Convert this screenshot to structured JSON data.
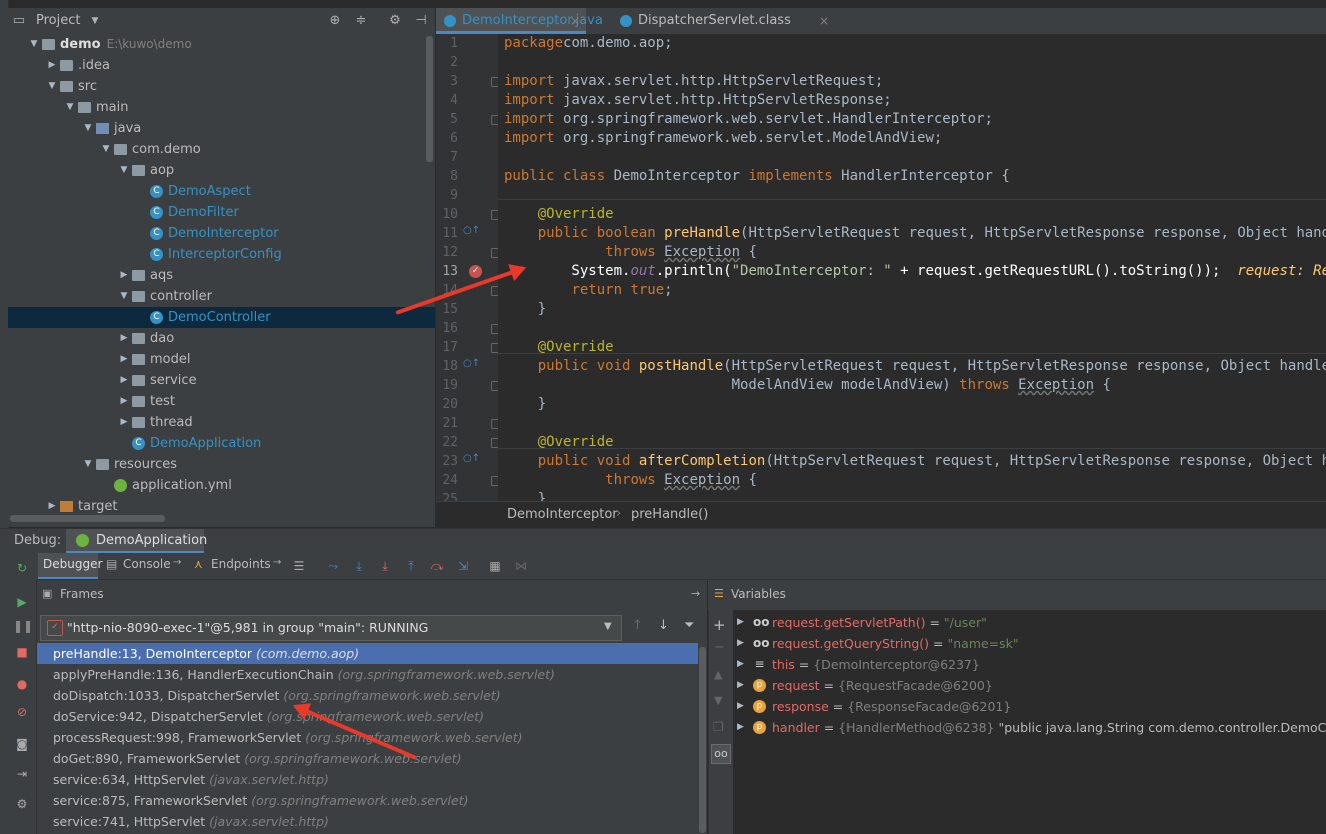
{
  "project_panel": {
    "title": "Project",
    "tree": [
      {
        "label": "demo",
        "path": "E:\\kuwo\\demo",
        "indent": 0,
        "arrow": "down",
        "icon": "folder-module",
        "bold": true
      },
      {
        "label": ".idea",
        "indent": 1,
        "arrow": "right",
        "icon": "folder"
      },
      {
        "label": "src",
        "indent": 1,
        "arrow": "down",
        "icon": "folder"
      },
      {
        "label": "main",
        "indent": 2,
        "arrow": "down",
        "icon": "folder"
      },
      {
        "label": "java",
        "indent": 3,
        "arrow": "down",
        "icon": "folder-blue"
      },
      {
        "label": "com.demo",
        "indent": 4,
        "arrow": "down",
        "icon": "folder"
      },
      {
        "label": "aop",
        "indent": 5,
        "arrow": "down",
        "icon": "folder"
      },
      {
        "label": "DemoAspect",
        "indent": 6,
        "arrow": "",
        "icon": "class"
      },
      {
        "label": "DemoFilter",
        "indent": 6,
        "arrow": "",
        "icon": "class"
      },
      {
        "label": "DemoInterceptor",
        "indent": 6,
        "arrow": "",
        "icon": "class"
      },
      {
        "label": "InterceptorConfig",
        "indent": 6,
        "arrow": "",
        "icon": "class2"
      },
      {
        "label": "aqs",
        "indent": 5,
        "arrow": "right",
        "icon": "folder"
      },
      {
        "label": "controller",
        "indent": 5,
        "arrow": "down",
        "icon": "folder"
      },
      {
        "label": "DemoController",
        "indent": 6,
        "arrow": "",
        "icon": "class",
        "selected": true
      },
      {
        "label": "dao",
        "indent": 5,
        "arrow": "right",
        "icon": "folder"
      },
      {
        "label": "model",
        "indent": 5,
        "arrow": "right",
        "icon": "folder"
      },
      {
        "label": "service",
        "indent": 5,
        "arrow": "right",
        "icon": "folder"
      },
      {
        "label": "test",
        "indent": 5,
        "arrow": "right",
        "icon": "folder"
      },
      {
        "label": "thread",
        "indent": 5,
        "arrow": "right",
        "icon": "folder"
      },
      {
        "label": "DemoApplication",
        "indent": 5,
        "arrow": "",
        "icon": "spring-class"
      },
      {
        "label": "resources",
        "indent": 3,
        "arrow": "down",
        "icon": "folder-res"
      },
      {
        "label": "application.yml",
        "indent": 4,
        "arrow": "",
        "icon": "spring"
      },
      {
        "label": "target",
        "indent": 1,
        "arrow": "right",
        "icon": "folder-orange"
      }
    ]
  },
  "editor": {
    "tabs": [
      {
        "label": "DemoInterceptor.java",
        "active": true,
        "close": "×"
      },
      {
        "label": "DispatcherServlet.class",
        "active": false,
        "close": "×"
      }
    ],
    "line_numbers": [
      "1",
      "2",
      "3",
      "4",
      "5",
      "6",
      "7",
      "8",
      "9",
      "10",
      "11",
      "12",
      "13",
      "14",
      "15",
      "16",
      "17",
      "18",
      "19",
      "20",
      "21",
      "22",
      "23",
      "24",
      "25"
    ],
    "current_line": "13",
    "breadcrumb": [
      "DemoInterceptor",
      "preHandle()"
    ],
    "breadcrumb_sep": "›"
  },
  "debug": {
    "label": "Debug:",
    "config_tab": "DemoApplication",
    "tabs": [
      "Debugger",
      "Console",
      "Endpoints"
    ],
    "frames_title": "Frames",
    "variables_title": "Variables",
    "thread": "\"http-nio-8090-exec-1\"@5,981 in group \"main\": RUNNING",
    "frames": [
      {
        "method": "preHandle:13, DemoInterceptor",
        "pkg": "(com.demo.aop)",
        "selected": true
      },
      {
        "method": "applyPreHandle:136, HandlerExecutionChain",
        "pkg": "(org.springframework.web.servlet)"
      },
      {
        "method": "doDispatch:1033, DispatcherServlet",
        "pkg": "(org.springframework.web.servlet)"
      },
      {
        "method": "doService:942, DispatcherServlet",
        "pkg": "(org.springframework.web.servlet)"
      },
      {
        "method": "processRequest:998, FrameworkServlet",
        "pkg": "(org.springframework.web.servlet)"
      },
      {
        "method": "doGet:890, FrameworkServlet",
        "pkg": "(org.springframework.web.servlet)"
      },
      {
        "method": "service:634, HttpServlet",
        "pkg": "(javax.servlet.http)"
      },
      {
        "method": "service:875, FrameworkServlet",
        "pkg": "(org.springframework.web.servlet)"
      },
      {
        "method": "service:741, HttpServlet",
        "pkg": "(javax.servlet.http)"
      }
    ],
    "variables": [
      {
        "icon": "oo",
        "name": "request.getServletPath()",
        "eq": " = ",
        "value": "\"/user\"",
        "kind": "str"
      },
      {
        "icon": "oo",
        "name": "request.getQueryString()",
        "eq": " = ",
        "value": "\"name=sk\"",
        "kind": "str"
      },
      {
        "icon": "list",
        "name": "this",
        "eq": " = ",
        "value": "{DemoInterceptor@6237}",
        "kind": "obj"
      },
      {
        "icon": "p",
        "name": "request",
        "eq": " = ",
        "value": "{RequestFacade@6200}",
        "kind": "obj"
      },
      {
        "icon": "p",
        "name": "response",
        "eq": " = ",
        "value": "{ResponseFacade@6201}",
        "kind": "obj"
      },
      {
        "icon": "p",
        "name": "handler",
        "eq": " = ",
        "value": "{HandlerMethod@6238}",
        "extra": " \"public java.lang.String com.demo.controller.DemoControlle",
        "kind": "obj"
      }
    ]
  },
  "colors": {
    "keyword": "#cc7832",
    "annotation": "#bbb529",
    "method": "#ffc66d",
    "string": "#6a8759",
    "selection": "#2f65ca",
    "arrow": "#e9392a"
  }
}
